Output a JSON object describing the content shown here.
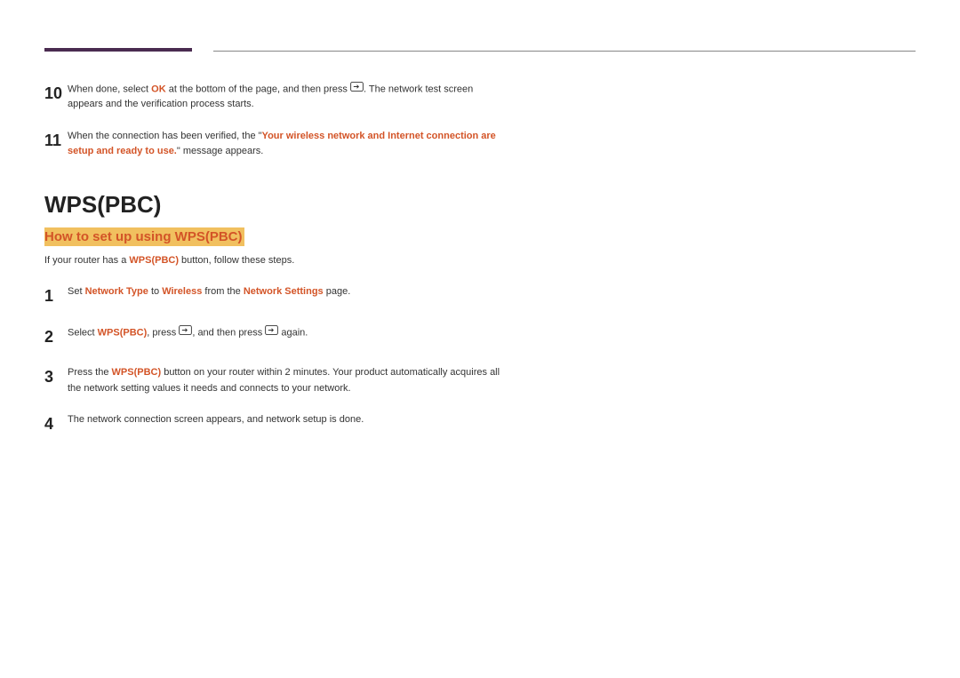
{
  "step10": {
    "num": "10",
    "t1": "When done, select ",
    "ok": "OK",
    "t2": " at the bottom of the page, and then press ",
    "t3": ". The network test screen appears and the verification process starts."
  },
  "step11": {
    "num": "11",
    "t1": "When the connection has been verified, the \"",
    "msg": "Your wireless network and Internet connection are setup and ready to use.",
    "t2": "\" message appears."
  },
  "heading": "WPS(PBC)",
  "subheading": "How to set up using WPS(PBC)",
  "intro": {
    "t1": "If your router has a ",
    "b": "WPS(PBC)",
    "t2": " button, follow these steps."
  },
  "s1": {
    "num": "1",
    "t1": "Set ",
    "b1": "Network Type",
    "t2": " to ",
    "b2": "Wireless",
    "t3": " from the ",
    "b3": "Network Settings",
    "t4": " page."
  },
  "s2": {
    "num": "2",
    "t1": "Select ",
    "b1": "WPS(PBC)",
    "t2": ", press ",
    "t3": ", and then press ",
    "t4": " again."
  },
  "s3": {
    "num": "3",
    "t1": "Press the ",
    "b1": "WPS(PBC)",
    "t2": " button on your router within 2 minutes. Your product automatically acquires all the network setting values it needs and connects to your network."
  },
  "s4": {
    "num": "4",
    "t1": "The network connection screen appears, and network setup is done."
  }
}
